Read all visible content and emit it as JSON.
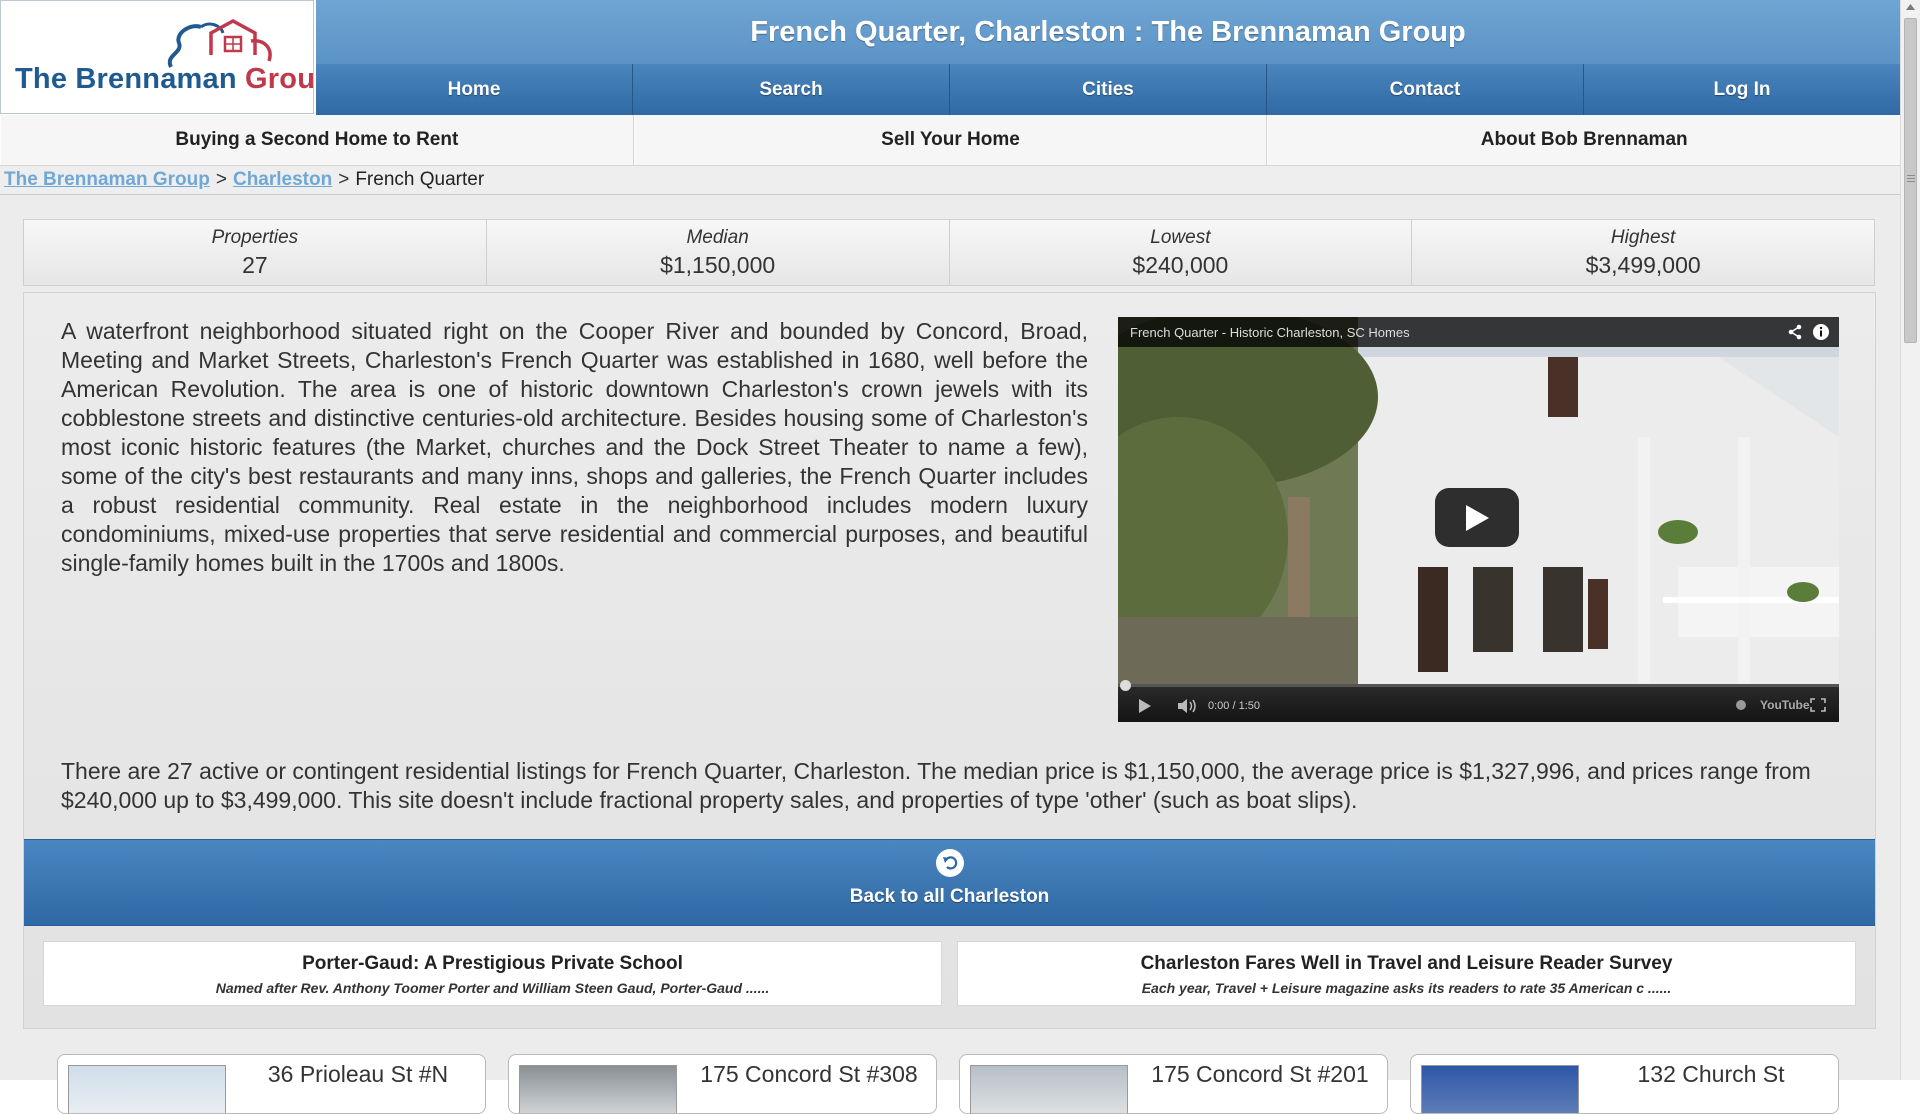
{
  "header": {
    "logo": {
      "part1": "The Brennaman",
      "part2": "Group"
    },
    "banner_title": "French Quarter, Charleston : The Brennaman Group",
    "nav": [
      "Home",
      "Search",
      "Cities",
      "Contact",
      "Log In"
    ],
    "subnav": [
      "Buying a Second Home to Rent",
      "Sell Your Home",
      "About Bob Brennaman"
    ],
    "colors": {
      "banner": "#6fa5d3",
      "nav": "#3a75b0",
      "logo_blue": "#1f5a90",
      "logo_red": "#c0394b"
    }
  },
  "breadcrumb": {
    "links": [
      "The Brennaman Group",
      "Charleston"
    ],
    "separator": ">",
    "current": "French Quarter"
  },
  "stats": [
    {
      "label": "Properties",
      "value": "27"
    },
    {
      "label": "Median",
      "value": "$1,150,000"
    },
    {
      "label": "Lowest",
      "value": "$240,000"
    },
    {
      "label": "Highest",
      "value": "$3,499,000"
    }
  ],
  "description": "A waterfront neighborhood situated right on the Cooper River and bounded by Concord, Broad, Meeting and Market Streets, Charleston's French Quarter was established in 1680, well before the American Revolution. The area is one of historic downtown Charleston's crown jewels with its cobblestone streets and distinctive centuries-old architecture. Besides housing some of Charleston's most iconic historic features (the Market, churches and the Dock Street Theater to name a few), some of the city's best restaurants and many inns, shops and galleries, the French Quarter includes a robust residential community. Real estate in the neighborhood includes modern luxury condominiums, mixed-use properties that serve residential and commercial purposes, and beautiful single-family homes built in the 1700s and 1800s.",
  "video": {
    "title": "French Quarter - Historic Charleston, SC Homes",
    "time": "0:00 / 1:50",
    "brand": "YouTube",
    "progress": 0
  },
  "summary": "There are 27 active or contingent residential listings for French Quarter, Charleston. The median price is $1,150,000, the average price is $1,327,996, and prices range from $240,000 up to $3,499,000. This site doesn't include fractional property sales, and properties of type 'other' (such as boat slips).",
  "back_button": {
    "label": "Back to all Charleston"
  },
  "blog": [
    {
      "title": "Porter-Gaud: A Prestigious Private School",
      "excerpt": "Named after Rev. Anthony Toomer Porter and William Steen Gaud, Porter-Gaud ......"
    },
    {
      "title": "Charleston Fares Well in Travel and Leisure Reader Survey",
      "excerpt": "Each year, Travel + Leisure magazine asks its readers to rate 35 American c ......"
    }
  ],
  "listings": [
    {
      "address": "36 Prioleau St #N"
    },
    {
      "address": "175 Concord St #308"
    },
    {
      "address": "175 Concord St #201"
    },
    {
      "address": "132 Church St"
    }
  ]
}
